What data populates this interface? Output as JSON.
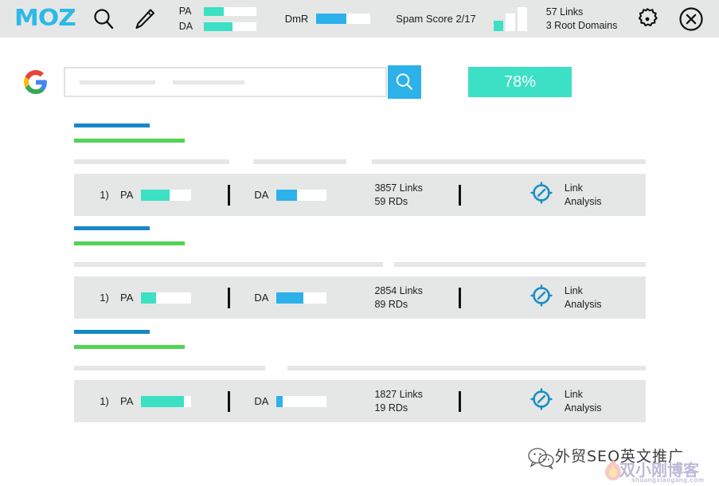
{
  "toolbar": {
    "brand": "MOZ",
    "search_icon": "search-icon",
    "pencil_icon": "pencil-icon",
    "page_metrics": [
      {
        "label": "PA",
        "fill_pct": 38,
        "color": "#3ce0c4"
      },
      {
        "label": "DA",
        "fill_pct": 55,
        "color": "#3ce0c4"
      }
    ],
    "dmr": {
      "label": "DmR",
      "fill_pct": 55,
      "color": "#2cb1ea"
    },
    "spam_score": "Spam Score 2/17",
    "spark_bars": [
      {
        "height": 13,
        "color": "#3ce0c4"
      },
      {
        "height": 22,
        "color": "#ffffff"
      },
      {
        "height": 30,
        "color": "#ffffff"
      }
    ],
    "links_summary": {
      "links": "57 Links",
      "root_domains": "3 Root Domains"
    },
    "gear_icon": "gear-icon",
    "close_icon": "close-circle-icon"
  },
  "serp": {
    "engine_logo": "google-logo",
    "search_input": {
      "value": "",
      "placeholder": "",
      "placeholder_bars": [
        95,
        90
      ]
    },
    "search_button_icon": "search-icon",
    "score_badge": "78%",
    "results": [
      {
        "rank": "1)",
        "title_bar_width": 95,
        "url_bar_width": 139,
        "desc_segments": [
          195,
          30,
          117,
          32,
          344
        ],
        "pa": {
          "label": "PA",
          "fill_pct": 57,
          "color": "#3ce0c4"
        },
        "da": {
          "label": "DA",
          "fill_pct": 40,
          "color": "#2cb1ea"
        },
        "links": "3857 Links",
        "root_domains": "59 RDs",
        "action_icon": "link-analysis-icon",
        "action_line1": "Link",
        "action_line2": "Analysis"
      },
      {
        "rank": "1)",
        "title_bar_width": 95,
        "url_bar_width": 139,
        "desc_segments": [
          388,
          14,
          316
        ],
        "pa": {
          "label": "PA",
          "fill_pct": 30,
          "color": "#3ce0c4"
        },
        "da": {
          "label": "DA",
          "fill_pct": 53,
          "color": "#2cb1ea"
        },
        "links": "2854 Links",
        "root_domains": "89 RDs",
        "action_icon": "link-analysis-icon",
        "action_line1": "Link",
        "action_line2": "Analysis"
      },
      {
        "rank": "1)",
        "title_bar_width": 95,
        "url_bar_width": 139,
        "desc_segments": [
          240,
          28,
          450
        ],
        "pa": {
          "label": "PA",
          "fill_pct": 85,
          "color": "#3ce0c4"
        },
        "da": {
          "label": "DA",
          "fill_pct": 12,
          "color": "#2cb1ea"
        },
        "links": "1827 Links",
        "root_domains": "19 RDs",
        "action_icon": "link-analysis-icon",
        "action_line1": "Link",
        "action_line2": "Analysis"
      }
    ]
  },
  "watermarks": {
    "wechat_icon": "wechat-icon",
    "cn_text": "外贸SEO英文推广",
    "blog_name": "双小刚博客",
    "site": "shuangxiaogang.com"
  },
  "colors": {
    "brand_blue": "#2cb9ea",
    "teal": "#3ce0c4",
    "blue": "#2cb1ea",
    "green": "#52d355",
    "toolbar_bg": "#e5e7e6",
    "title_blue": "#1787c9"
  }
}
